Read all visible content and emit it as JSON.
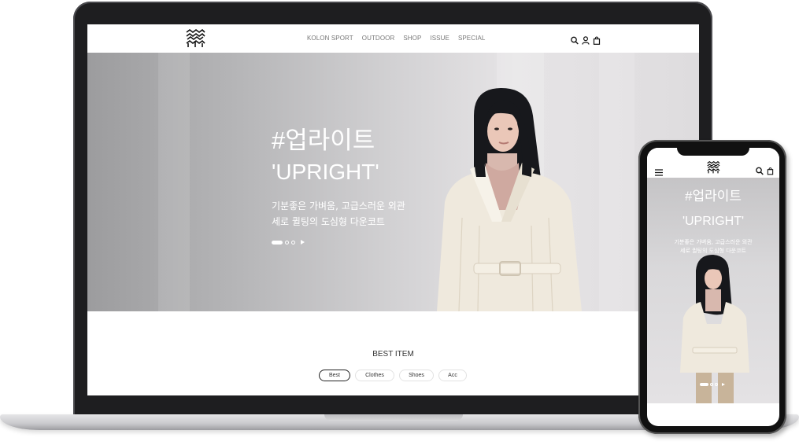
{
  "desktop": {
    "nav": [
      "KOLON SPORT",
      "OUTDOOR",
      "SHOP",
      "ISSUE",
      "SPECIAL"
    ],
    "icons": [
      "search-icon",
      "user-icon",
      "shopping-bag-icon"
    ],
    "hero": {
      "title": "#업라이트",
      "title2": "'UPRIGHT'",
      "subtitle1": "기분좋은 가벼움, 고급스러운 외관",
      "subtitle2": "세로 퀼팅의 도심형 다운코트"
    },
    "best": {
      "title": "BEST ITEM",
      "tabs": [
        "Best",
        "Clothes",
        "Shoes",
        "Acc"
      ],
      "active_tab": "Best"
    }
  },
  "mobile": {
    "icons": [
      "menu-icon",
      "search-icon",
      "shopping-bag-icon"
    ],
    "hero": {
      "title": "#업라이트",
      "title2": "'UPRIGHT'",
      "subtitle1": "기분좋은 가벼움, 고급스러운 외관",
      "subtitle2": "세로 퀼팅의 도심형 다운코트"
    }
  },
  "colors": {
    "hero_text": "#ffffff",
    "coat": "#efe9dd",
    "hair": "#17181c",
    "device": "#1e1e20"
  }
}
